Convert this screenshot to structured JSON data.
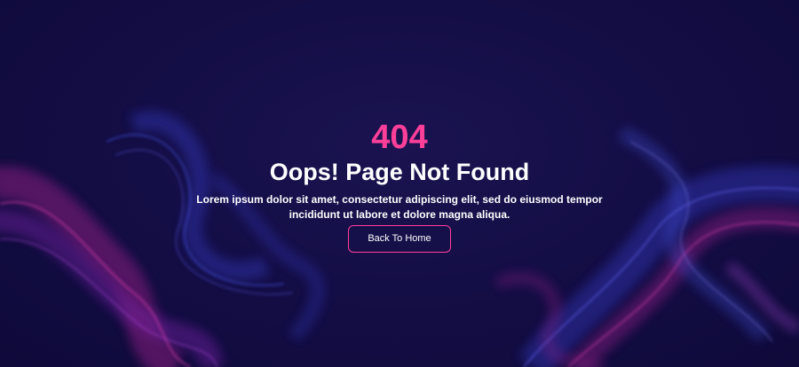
{
  "error": {
    "code": "404",
    "title": "Oops! Page Not Found",
    "description": "Lorem ipsum dolor sit amet, consectetur adipiscing elit, sed do eiusmod tempor incididunt ut labore et dolore magna aliqua.",
    "button_label": "Back To Home"
  },
  "colors": {
    "background": "#140f47",
    "accent": "#ff3f9a",
    "text": "#ffffff",
    "swirl_blue": "#3a3fd0",
    "swirl_magenta": "#c0269a"
  },
  "icons": [
    "light-swirl-background"
  ]
}
